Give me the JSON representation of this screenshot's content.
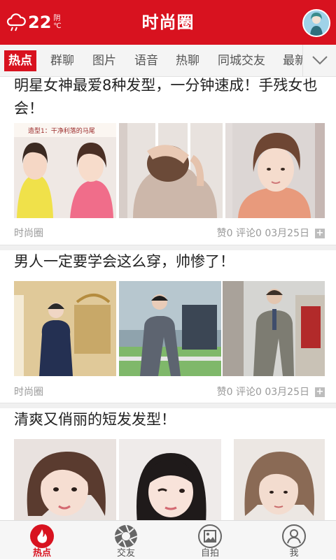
{
  "header": {
    "temperature": "22",
    "weather_condition": "阴",
    "temperature_unit": "℃",
    "title": "时尚圈"
  },
  "tabs": [
    {
      "label": "热点",
      "active": true
    },
    {
      "label": "群聊"
    },
    {
      "label": "图片"
    },
    {
      "label": "语音"
    },
    {
      "label": "热聊"
    },
    {
      "label": "同城交友"
    },
    {
      "label": "最新"
    }
  ],
  "articles": [
    {
      "title": "明星女神最爱8种发型，一分钟速成！手残女也会！",
      "thumb_caption": "造型1：干净利落的马尾",
      "source": "时尚圈",
      "likes": "赞0",
      "comments": "评论0",
      "date": "03月25日"
    },
    {
      "title": "男人一定要学会这么穿，帅惨了！",
      "source": "时尚圈",
      "likes": "赞0",
      "comments": "评论0",
      "date": "03月25日"
    },
    {
      "title": "清爽又俏丽的短发发型！"
    }
  ],
  "bottom_nav": [
    {
      "label": "热点",
      "icon": "flame-icon",
      "active": true
    },
    {
      "label": "交友",
      "icon": "aperture-icon"
    },
    {
      "label": "自拍",
      "icon": "picture-icon"
    },
    {
      "label": "我",
      "icon": "user-icon"
    }
  ],
  "colors": {
    "accent": "#d8121f"
  }
}
